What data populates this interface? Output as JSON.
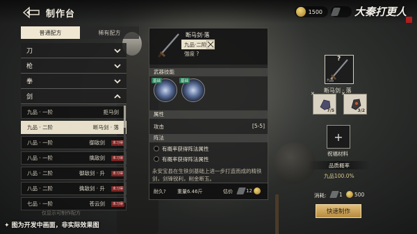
{
  "header": {
    "title": "制作台",
    "coins": "1500",
    "knife_count": "",
    "logo": "大秦打更人"
  },
  "recipe_tabs": {
    "normal": "普通配方",
    "rare": "稀有配方"
  },
  "categories": [
    {
      "label": "刀",
      "state": "collapsed"
    },
    {
      "label": "枪",
      "state": "collapsed"
    },
    {
      "label": "拳",
      "state": "collapsed"
    },
    {
      "label": "剑",
      "state": "expanded"
    }
  ],
  "sword_items": [
    {
      "grade": "九品 · 一阶",
      "name": "拒马剑",
      "tag": "",
      "selected": false
    },
    {
      "grade": "九品 · 二阶",
      "name": "断马剑 · 落",
      "tag": "",
      "selected": true
    },
    {
      "grade": "八品 · 一阶",
      "name": "御敌剑",
      "tag": "未习得",
      "selected": false
    },
    {
      "grade": "八品 · 一阶",
      "name": "擒敌剑",
      "tag": "未习得",
      "selected": false
    },
    {
      "grade": "八品 · 二阶",
      "name": "御敌剑 · 升",
      "tag": "未习得",
      "selected": false
    },
    {
      "grade": "八品 · 二阶",
      "name": "擒敌剑 · 升",
      "tag": "未习得",
      "selected": false
    },
    {
      "grade": "七品 · 一阶",
      "name": "苍云剑",
      "tag": "未习得",
      "selected": false
    }
  ],
  "hint_text": "仅显示可制作配方",
  "weapon": {
    "name": "断马剑·落",
    "grade": "九品·二阶",
    "strength": "强度 ?",
    "skills_header": "武器技能",
    "skill_tag_1": "基础",
    "skill_tag_2": "基础",
    "attr_header": "属性",
    "attr_label": "攻击",
    "attr_value": "[5-5]",
    "formation_header": "阵法",
    "formation_1": "有概率获得阵法属性",
    "formation_2": "有概率获得阵法属性",
    "description": "永安宝县在生铁剑基础上进一步打造而成的精铁剑，剑锋锐利，削金断玉。",
    "durability": "耐久?",
    "weight": "重量6.46斤",
    "estimate_label": "估价",
    "estimate_knife": "12",
    "estimate_coin": ""
  },
  "right_panel": {
    "weapon_grade": "九品",
    "weapon_name": "断马剑 · 落",
    "mat1_count": "7/5",
    "mat2_count": "3/2",
    "bless_label": "祝福材料",
    "rate_label": "品质概率",
    "rate_value": "九品100.0%",
    "consume_label": "消耗:",
    "consume_knife": "1",
    "consume_coin": "500",
    "quick_button": "快速制作"
  },
  "bottom_note": "✦ 图为开发中画面，非实际效果图"
}
